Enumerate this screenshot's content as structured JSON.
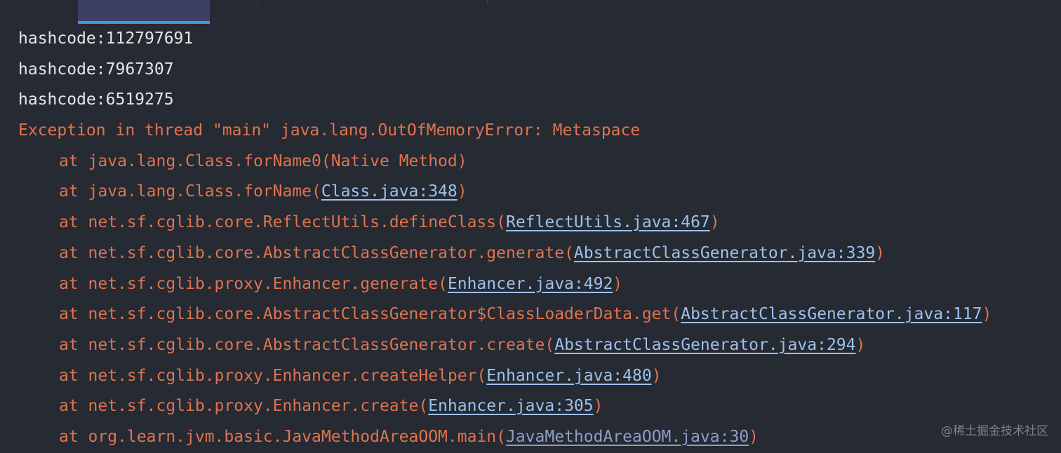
{
  "console": {
    "output_lines": [
      "hashcode:112797691",
      "hashcode:7967307",
      "hashcode:6519275"
    ],
    "exception": "Exception in thread \"main\" java.lang.OutOfMemoryError: Metaspace",
    "stack_frames": [
      {
        "prefix": "at java.lang.Class.forName0(Native Method)",
        "link": "",
        "suffix": ""
      },
      {
        "prefix": "at java.lang.Class.forName(",
        "link": "Class.java:348",
        "suffix": ")"
      },
      {
        "prefix": "at net.sf.cglib.core.ReflectUtils.defineClass(",
        "link": "ReflectUtils.java:467",
        "suffix": ")"
      },
      {
        "prefix": "at net.sf.cglib.core.AbstractClassGenerator.generate(",
        "link": "AbstractClassGenerator.java:339",
        "suffix": ")"
      },
      {
        "prefix": "at net.sf.cglib.proxy.Enhancer.generate(",
        "link": "Enhancer.java:492",
        "suffix": ")"
      },
      {
        "prefix": "at net.sf.cglib.core.AbstractClassGenerator$ClassLoaderData.get(",
        "link": "AbstractClassGenerator.java:117",
        "suffix": ")"
      },
      {
        "prefix": "at net.sf.cglib.core.AbstractClassGenerator.create(",
        "link": "AbstractClassGenerator.java:294",
        "suffix": ")"
      },
      {
        "prefix": "at net.sf.cglib.proxy.Enhancer.createHelper(",
        "link": "Enhancer.java:480",
        "suffix": ")"
      },
      {
        "prefix": "at net.sf.cglib.proxy.Enhancer.create(",
        "link": "Enhancer.java:305",
        "suffix": ")"
      },
      {
        "prefix": "at org.learn.jvm.basic.JavaMethodAreaOOM.main(",
        "link": "JavaMethodAreaOOM.java:30",
        "suffix": ")"
      }
    ]
  },
  "watermark": "@稀土掘金技术社区",
  "colors": {
    "background": "#252a33",
    "stdout_text": "#e6e6e6",
    "stderr_text": "#e0734f",
    "link": "#9ec1ec",
    "tab_active": "#3d3f63",
    "tab_indicator": "#3d97e6"
  }
}
